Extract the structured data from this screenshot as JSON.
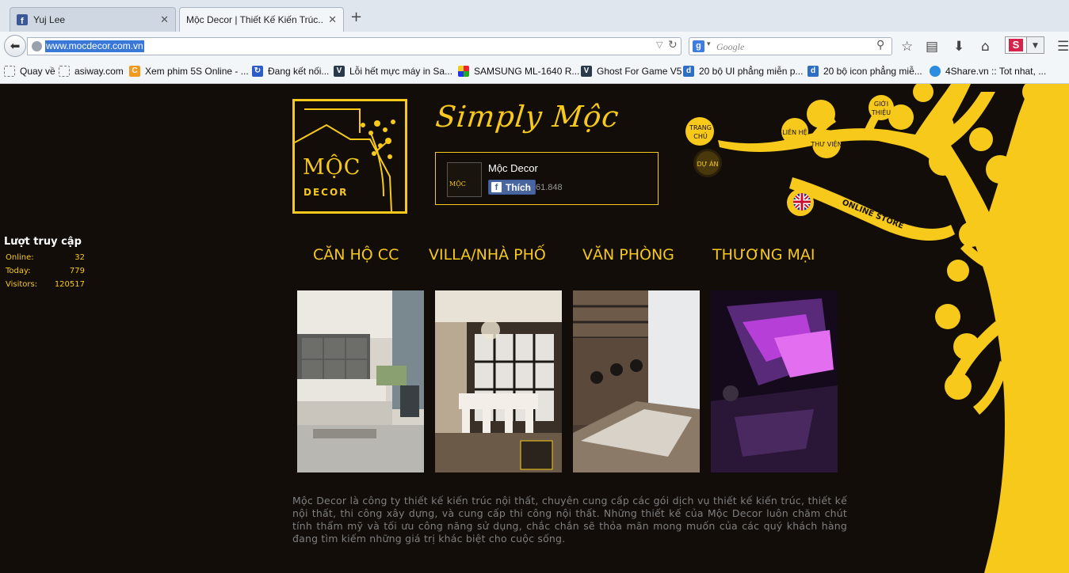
{
  "browser": {
    "tabs": [
      {
        "label": "Yuj Lee",
        "active": false
      },
      {
        "label": "Mộc Decor | Thiết Kế Kiến Trúc...",
        "active": true
      }
    ],
    "new_tab_symbol": "+",
    "url": "www.mocdecor.com.vn",
    "search_placeholder": "Google",
    "bookmarks": [
      {
        "label": "Quay về",
        "icon": "blank-page-icon"
      },
      {
        "label": "asiway.com",
        "icon": "blank-page-icon"
      },
      {
        "label": "Xem phim 5S Online - ...",
        "icon": "c-logo-icon"
      },
      {
        "label": "Đang kết nối...",
        "icon": "loading-icon"
      },
      {
        "label": "Lỗi hết mực máy in Sa...",
        "icon": "v-logo-icon"
      },
      {
        "label": "SAMSUNG ML-1640 R...",
        "icon": "colorful-logo-icon"
      },
      {
        "label": "Ghost For Game V5",
        "icon": "v-logo-icon"
      },
      {
        "label": "20 bộ UI phẳng miễn p...",
        "icon": "d-logo-icon"
      },
      {
        "label": "20 bộ icon phẳng miễ...",
        "icon": "d-logo-icon"
      },
      {
        "label": "4Share.vn :: Tot nhat, ...",
        "icon": "cloud-icon"
      }
    ],
    "colors": {
      "selection": "#3a78d8",
      "chrome": "#f3f6f9"
    }
  },
  "site": {
    "logo_text": "MỘC",
    "logo_sub": "DECOR",
    "slogan": "Simply Mộc",
    "facebook": {
      "page_name": "Mộc Decor",
      "like_label": "Thích",
      "like_count": "61.848"
    },
    "tree_menu": {
      "home": "TRANG CHỦ",
      "home_l1": "TRANG",
      "home_l2": "CHỦ",
      "projects": "DỰ ÁN",
      "contact": "LIÊN HỆ",
      "library": "THƯ VIỆN",
      "about_l1": "GIỚI",
      "about_l2": "THIỆU",
      "online_store": "ONLINE STORE",
      "language_icon": "uk-flag-icon"
    },
    "counter": {
      "title": "Lượt truy cập",
      "rows": [
        {
          "label": "Online:",
          "value": "32"
        },
        {
          "label": "Today:",
          "value": "779"
        },
        {
          "label": "Visitors:",
          "value": "120517"
        }
      ]
    },
    "categories": [
      "CĂN HỘ CC",
      "VILLA/NHÀ PHỐ",
      "VĂN PHÒNG",
      "THƯƠNG MẠI"
    ],
    "description": "Mộc Decor là công ty thiết kế kiến trúc nội thất, chuyên cung cấp các gói dịch vụ thiết kế kiến trúc, thiết kế nội thất, thi công xây dựng, và cung cấp thi công nội thất. Những thiết kế của Mộc Decor luôn chăm chút tính thẩm mỹ và tối ưu công năng sử dụng, chắc chắn sẽ thỏa mãn mong muốn của các quý khách hàng đang tìm kiếm những giá trị khác biệt cho cuộc sống.",
    "colors": {
      "background": "#120d09",
      "accent": "#f6c91b",
      "text_muted": "#7f7f7f"
    }
  }
}
